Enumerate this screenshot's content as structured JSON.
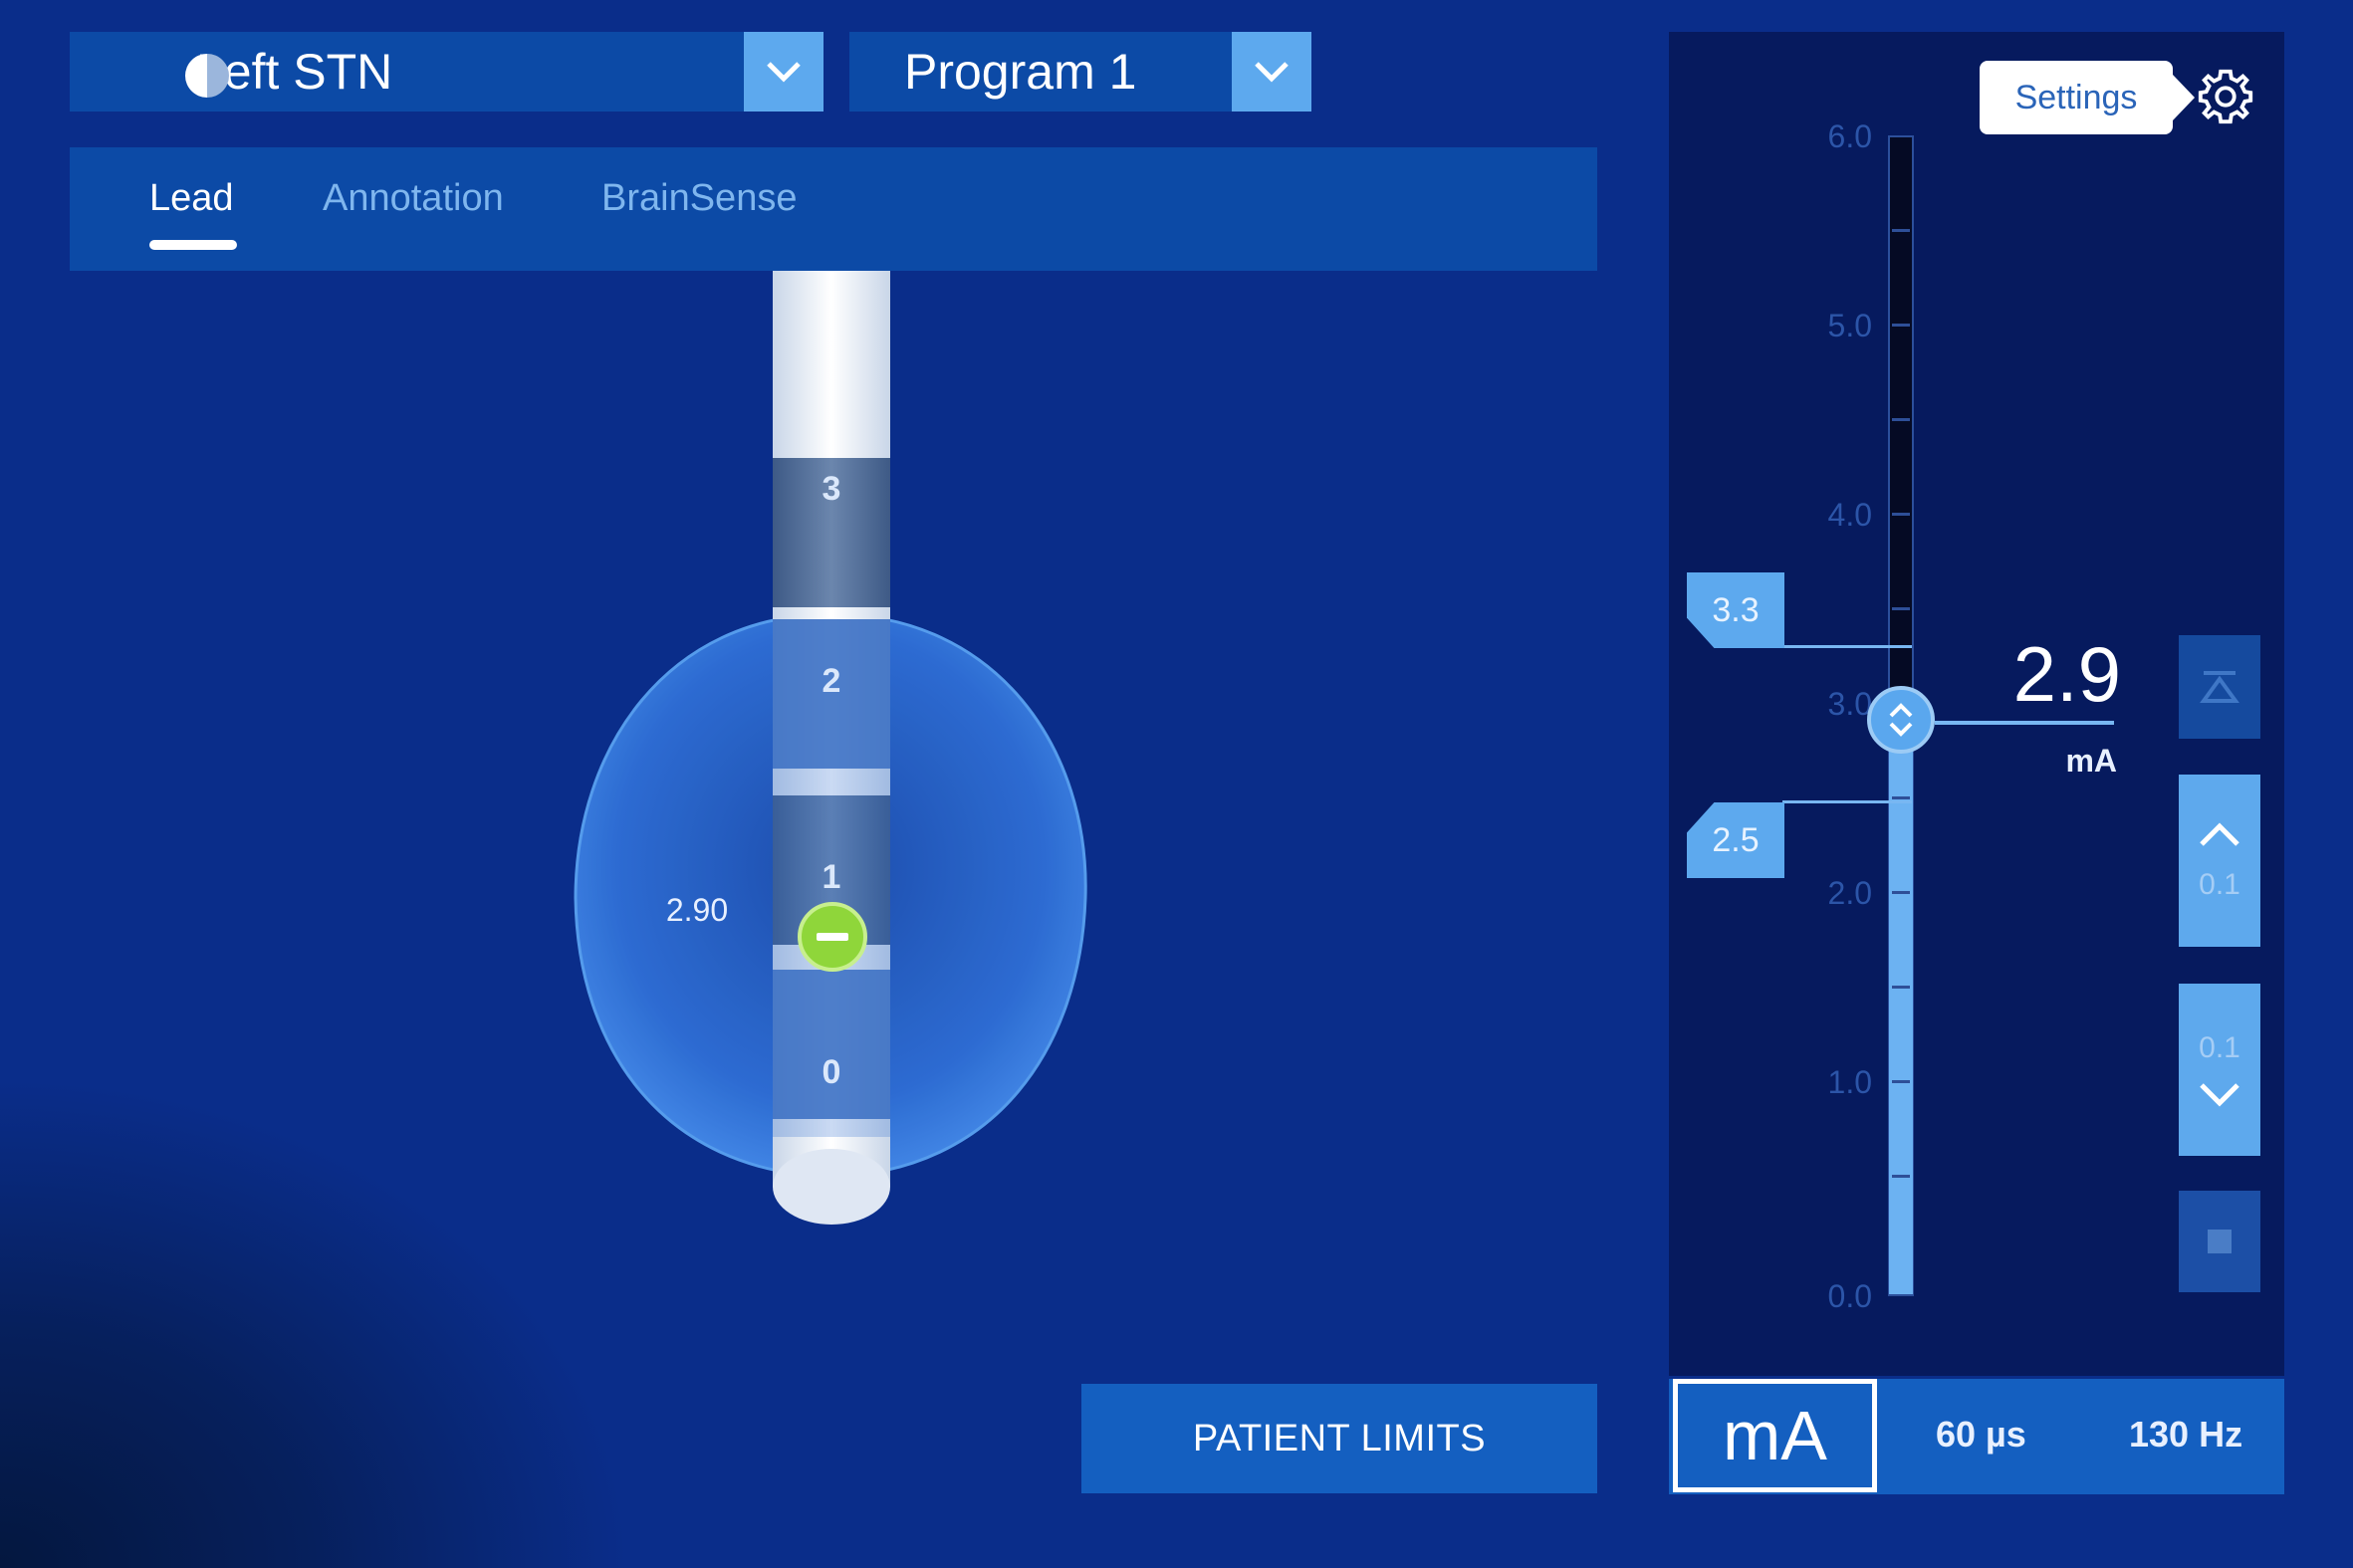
{
  "header": {
    "hemisphere": {
      "label": "Left STN",
      "icon": "half-circle-icon"
    },
    "program": {
      "label": "Program 1"
    }
  },
  "tabs": [
    {
      "label": "Lead",
      "active": true
    },
    {
      "label": "Annotation",
      "active": false
    },
    {
      "label": "BrainSense",
      "active": false
    }
  ],
  "lead": {
    "contacts": [
      "3",
      "2",
      "1",
      "0"
    ],
    "active_contact": "1",
    "active_polarity": "minus-icon",
    "amplitude_label": "2.90"
  },
  "amplitude_panel": {
    "settings_label": "Settings",
    "scale_ticks": [
      "6.0",
      "5.0",
      "4.0",
      "3.0",
      "2.0",
      "1.0",
      "0.0"
    ],
    "scale_min": 0.0,
    "scale_max": 6.0,
    "upper_limit": "3.3",
    "lower_limit": "2.5",
    "current_value": "2.9",
    "current_value_number": 2.9,
    "unit": "mA",
    "step_up": "0.1",
    "step_down": "0.1"
  },
  "bottom": {
    "patient_limits_label": "PATIENT LIMITS",
    "unit_button": "mA",
    "pulse_width": "60 µs",
    "frequency": "130 Hz"
  },
  "colors": {
    "background": "#0a2d8a",
    "panel": "#0c4aa6",
    "accent": "#5da9ee",
    "active_contact": "#8fd63a"
  }
}
